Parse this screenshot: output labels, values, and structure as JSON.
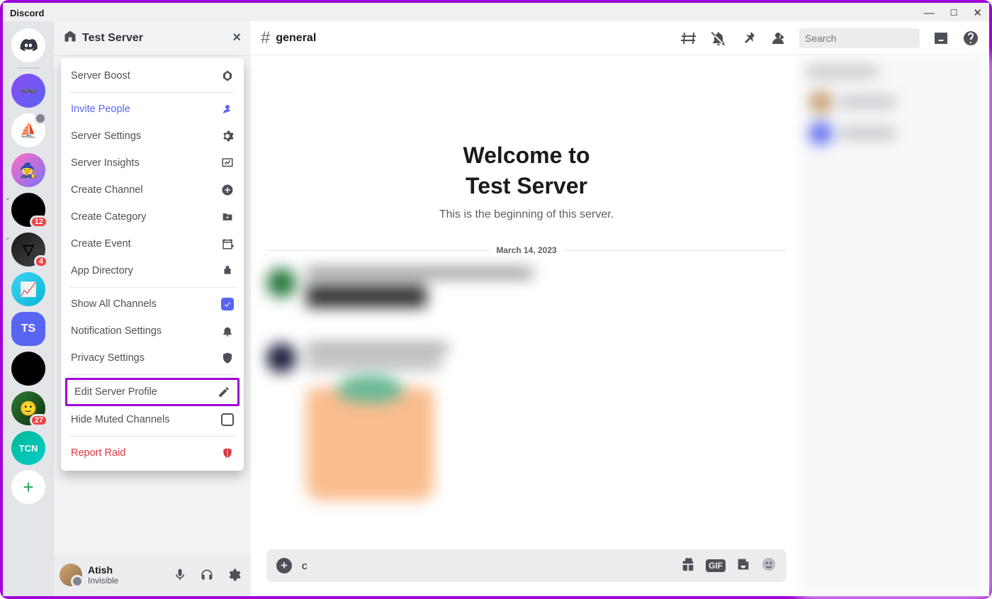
{
  "app_title": "Discord",
  "server_rail": {
    "home": {
      "name": "discord-home"
    },
    "servers": [
      {
        "name": "server-wavelength",
        "bg": "linear-gradient(135deg,#8a4af3,#5865f2)",
        "initials": "",
        "image": "wave"
      },
      {
        "name": "server-midjourney",
        "bg": "#fff",
        "initials": "",
        "image": "sailboat",
        "muted": true
      },
      {
        "name": "server-fantasy",
        "bg": "linear-gradient(135deg,#ff6ec4,#7873f5)",
        "initials": "",
        "image": "wizard"
      },
      {
        "name": "server-opensea",
        "bg": "#000",
        "initials": "",
        "image": "opus",
        "badge": "12",
        "chevron": true
      },
      {
        "name": "server-triangle",
        "bg": "linear-gradient(135deg,#1a1a1a,#444)",
        "initials": "",
        "image": "triangle",
        "badge": "4",
        "chevron": true
      },
      {
        "name": "server-stocks",
        "bg": "linear-gradient(135deg,#3dd5f3,#06b6d4)",
        "initials": "",
        "image": "arrowchart"
      },
      {
        "name": "server-test",
        "bg": "#5865f2",
        "initials": "TS",
        "image": "none",
        "selected": true
      },
      {
        "name": "server-chatgpt",
        "bg": "#000",
        "initials": "",
        "image": "knot"
      },
      {
        "name": "server-user1",
        "bg": "linear-gradient(135deg,#2e7d32,#0d2e10)",
        "initials": "",
        "image": "face",
        "badge": "27"
      },
      {
        "name": "server-ten",
        "bg": "linear-gradient(135deg,#00b894,#00cec9)",
        "initials": "",
        "image": "ten"
      }
    ],
    "add_server_icon": "+"
  },
  "server_header": {
    "home_icon": "home",
    "title": "Test Server",
    "close_icon": "×"
  },
  "menu": [
    {
      "label": "Server Boost",
      "icon": "boost",
      "type": "normal"
    },
    {
      "divider": true
    },
    {
      "label": "Invite People",
      "icon": "invite",
      "type": "accent"
    },
    {
      "label": "Server Settings",
      "icon": "gear",
      "type": "normal"
    },
    {
      "label": "Server Insights",
      "icon": "insights",
      "type": "normal"
    },
    {
      "label": "Create Channel",
      "icon": "plus-circle",
      "type": "normal"
    },
    {
      "label": "Create Category",
      "icon": "folder-plus",
      "type": "normal"
    },
    {
      "label": "Create Event",
      "icon": "calendar-plus",
      "type": "normal"
    },
    {
      "label": "App Directory",
      "icon": "robot",
      "type": "normal"
    },
    {
      "divider": true
    },
    {
      "label": "Show All Channels",
      "icon": "checkbox-on",
      "type": "normal",
      "checked": true
    },
    {
      "label": "Notification Settings",
      "icon": "bell",
      "type": "normal"
    },
    {
      "label": "Privacy Settings",
      "icon": "shield",
      "type": "normal"
    },
    {
      "divider": true
    },
    {
      "label": "Edit Server Profile",
      "icon": "pencil",
      "type": "normal",
      "highlighted": true
    },
    {
      "label": "Hide Muted Channels",
      "icon": "checkbox-off",
      "type": "normal",
      "checked": false
    },
    {
      "divider": true
    },
    {
      "label": "Report Raid",
      "icon": "shield-alert",
      "type": "danger"
    }
  ],
  "user_panel": {
    "username": "Atish",
    "status": "Invisible"
  },
  "channel_header": {
    "hash": "#",
    "channel_name": "general",
    "search_placeholder": "Search"
  },
  "chat": {
    "welcome_line1": "Welcome to",
    "welcome_line2": "Test Server",
    "welcome_sub": "This is the beginning of this server.",
    "date_divider": "March 14, 2023",
    "compose_text": "c"
  },
  "colors": {
    "accent": "#5865f2",
    "danger": "#da373c",
    "highlight_border": "#a000d8"
  }
}
